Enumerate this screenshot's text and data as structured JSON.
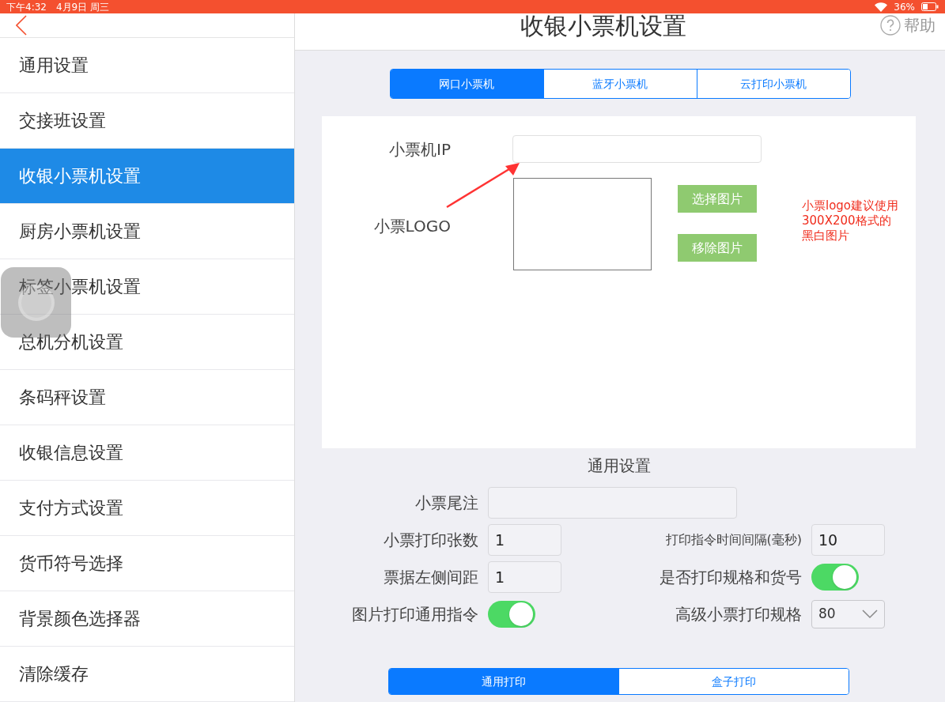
{
  "status_bar": {
    "time": "下午4:32",
    "date": "4月9日 周三",
    "battery": "36%"
  },
  "header": {
    "title": "收银小票机设置",
    "help": "帮助"
  },
  "sidebar": {
    "items": [
      {
        "label": "通用设置",
        "selected": false
      },
      {
        "label": "交接班设置",
        "selected": false
      },
      {
        "label": "收银小票机设置",
        "selected": true
      },
      {
        "label": "厨房小票机设置",
        "selected": false
      },
      {
        "label": "标签小票机设置",
        "selected": false
      },
      {
        "label": "总机分机设置",
        "selected": false
      },
      {
        "label": "条码秤设置",
        "selected": false
      },
      {
        "label": "收银信息设置",
        "selected": false
      },
      {
        "label": "支付方式设置",
        "selected": false
      },
      {
        "label": "货币符号选择",
        "selected": false
      },
      {
        "label": "背景颜色选择器",
        "selected": false
      },
      {
        "label": "清除缓存",
        "selected": false
      }
    ]
  },
  "printer_tabs": [
    {
      "label": "网口小票机",
      "selected": true
    },
    {
      "label": "蓝牙小票机",
      "selected": false
    },
    {
      "label": "云打印小票机",
      "selected": false
    }
  ],
  "printer_ip": {
    "label": "小票机IP"
  },
  "logo": {
    "label": "小票LOGO",
    "buttons": [
      "选择图片",
      "移除图片"
    ],
    "note": [
      "小票logo建议使用",
      "300X200格式的",
      "黑白图片"
    ]
  },
  "general": {
    "title": "通用设置",
    "rows": [
      {
        "fields": [
          {
            "kind": "input",
            "label": "小票尾注",
            "wide": true
          }
        ]
      },
      {
        "fields": [
          {
            "kind": "input",
            "label": "小票打印张数",
            "value": "1"
          },
          {
            "kind": "input",
            "label": "打印指令时间间隔(毫秒)",
            "value": "10",
            "small": true
          }
        ]
      },
      {
        "fields": [
          {
            "kind": "input",
            "label": "票据左侧间距",
            "value": "1"
          },
          {
            "kind": "toggle",
            "label": "是否打印规格和货号",
            "on": true
          }
        ]
      },
      {
        "fields": [
          {
            "kind": "toggle",
            "label": "图片打印通用指令",
            "on": true
          },
          {
            "kind": "select",
            "label": "高级小票打印规格",
            "value": "80"
          }
        ]
      }
    ]
  },
  "print_tabs": [
    {
      "label": "通用打印",
      "selected": true
    },
    {
      "label": "盒子打印",
      "selected": false
    }
  ]
}
